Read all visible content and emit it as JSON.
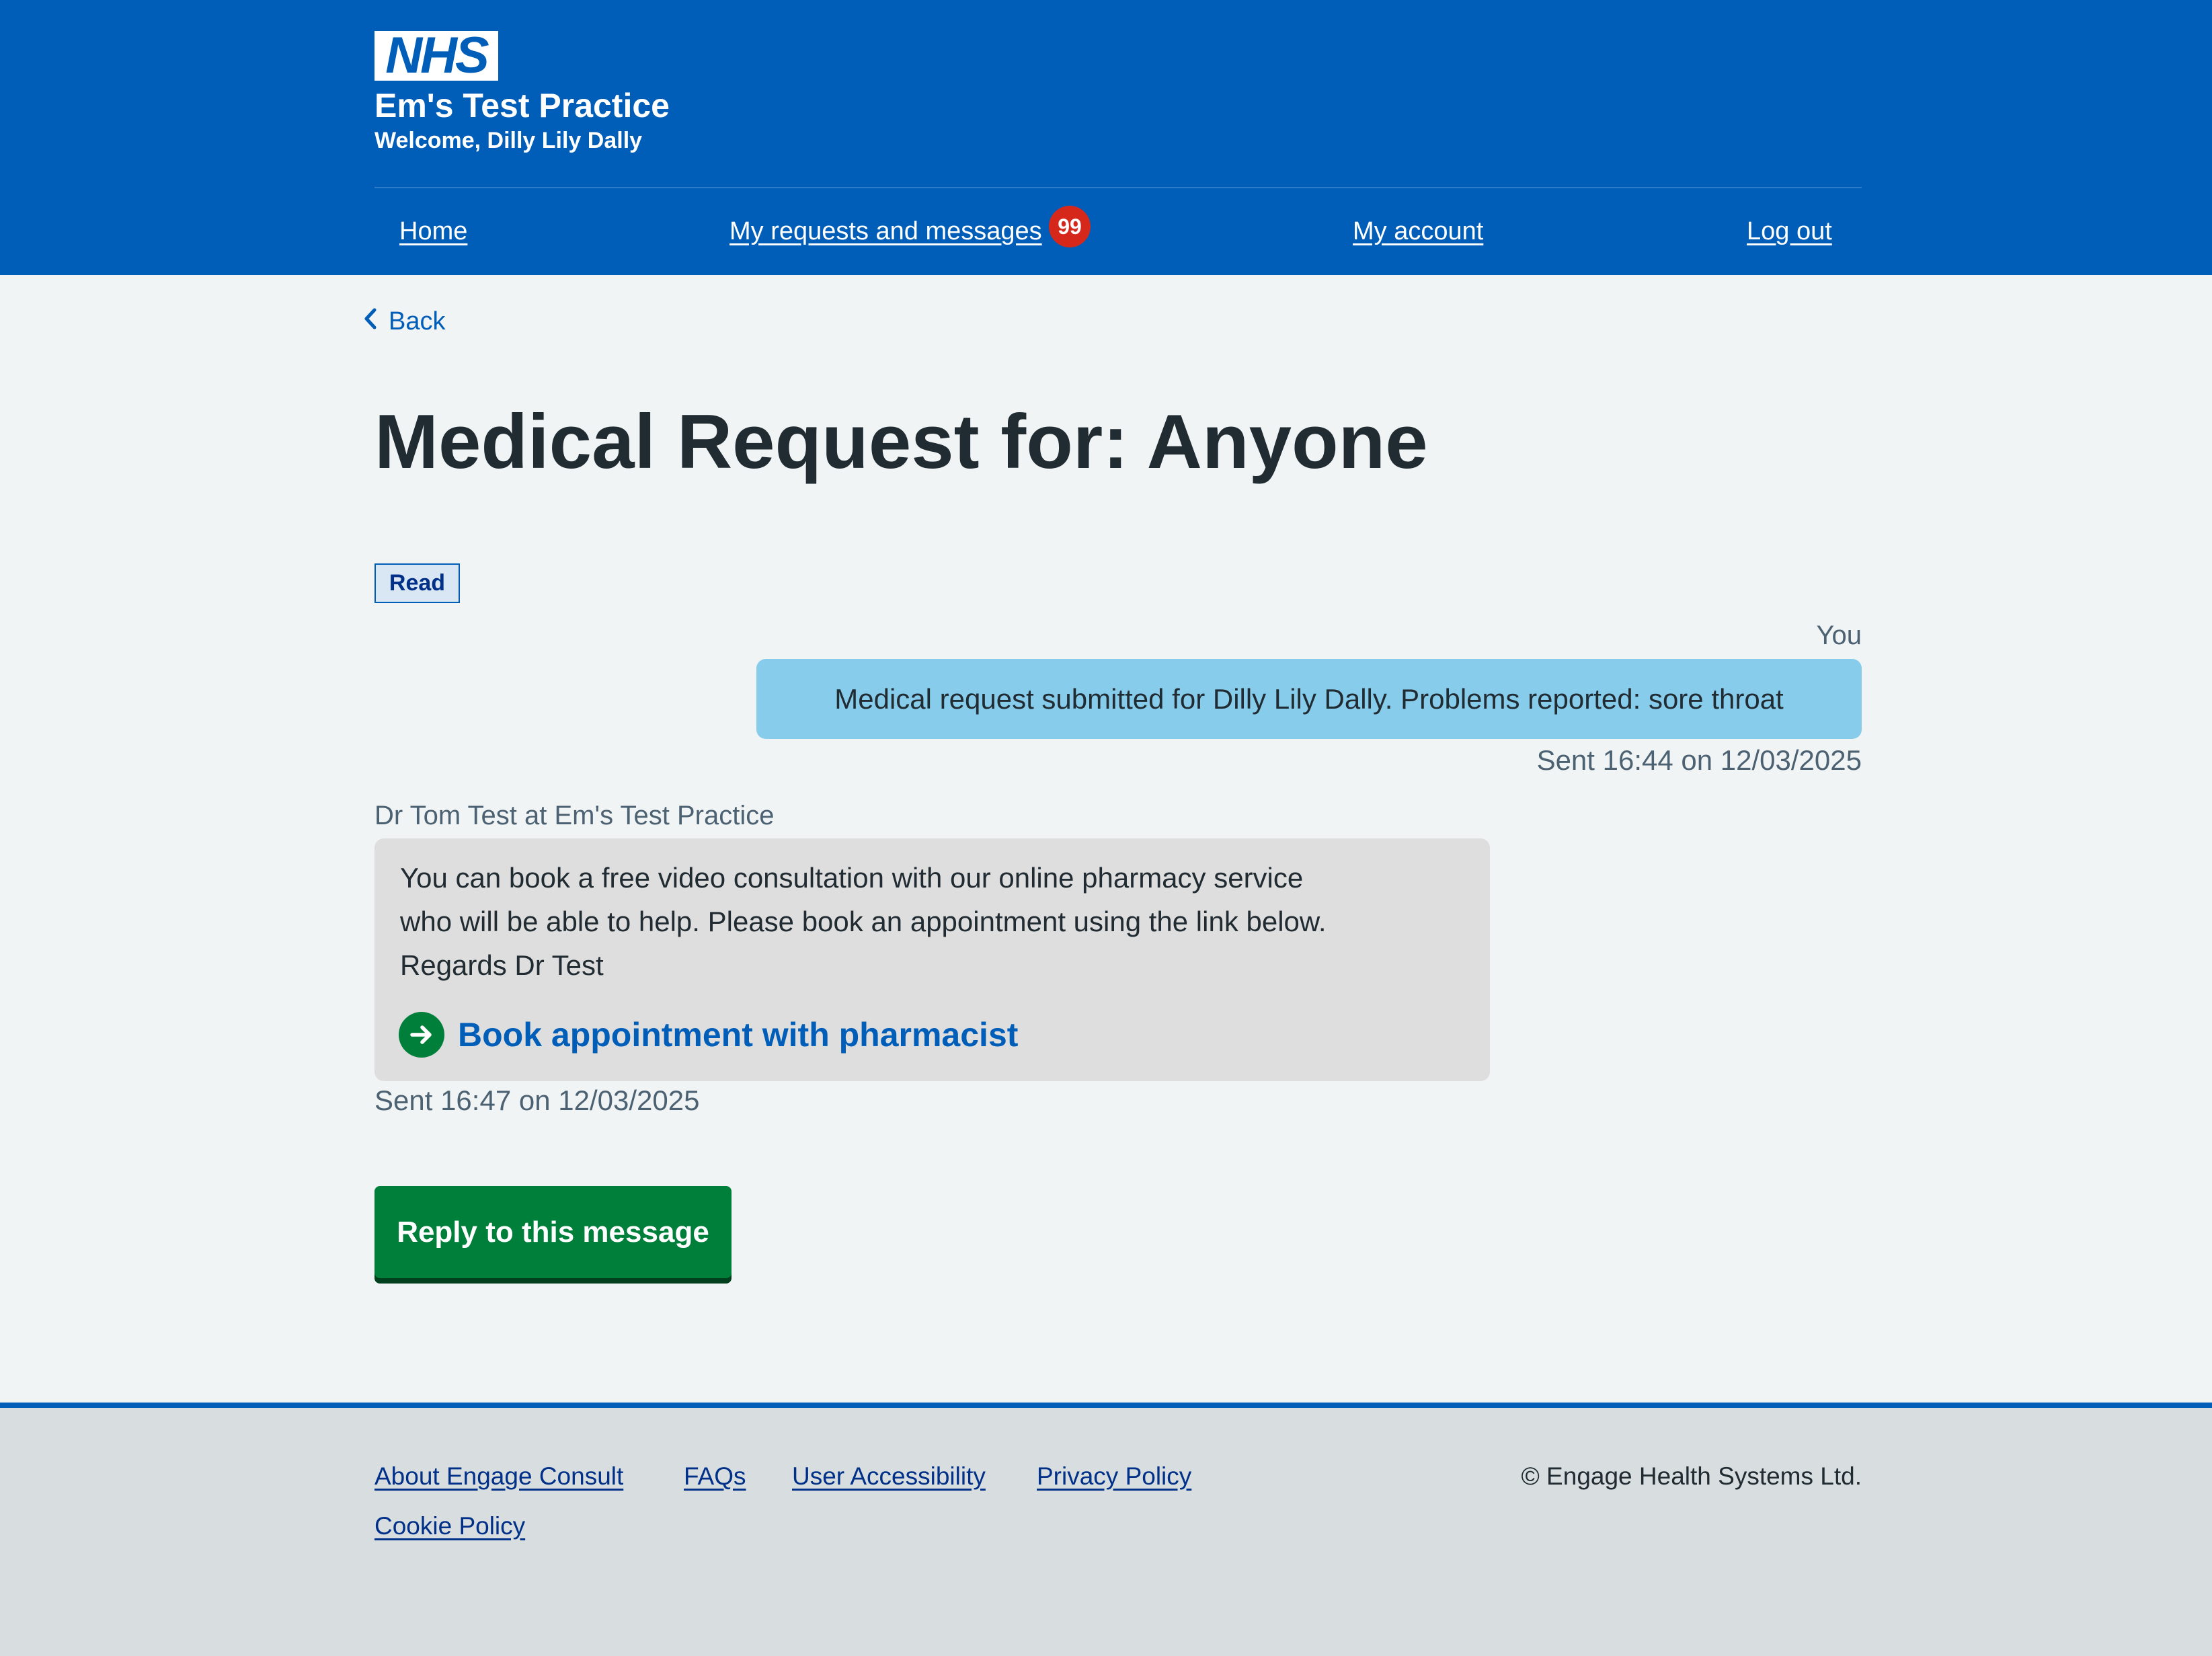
{
  "header": {
    "logo_text": "NHS",
    "practice_name": "Em's Test Practice",
    "welcome": "Welcome, Dilly Lily Dally",
    "nav": [
      {
        "label": "Home"
      },
      {
        "label": "My requests and messages",
        "badge": "99"
      },
      {
        "label": "My account"
      },
      {
        "label": "Log out"
      }
    ]
  },
  "main": {
    "back_label": "Back",
    "title": "Medical Request for: Anyone",
    "status_tag": "Read",
    "messages": [
      {
        "sender": "You",
        "text": "Medical request submitted for Dilly Lily Dally. Problems reported: sore throat",
        "sent": "Sent 16:44 on 12/03/2025"
      },
      {
        "sender": "Dr Tom Test at Em's Test Practice",
        "text_lines": [
          "You can book a free video consultation with our online pharmacy service",
          "who will be able to help. Please book an appointment using the link below.",
          "Regards Dr Test"
        ],
        "action_link": "Book appointment with pharmacist",
        "sent": "Sent 16:47 on 12/03/2025"
      }
    ],
    "reply_button": "Reply to this message"
  },
  "footer": {
    "links": [
      {
        "label": "About Engage Consult"
      },
      {
        "label": "FAQs"
      },
      {
        "label": "User Accessibility"
      },
      {
        "label": "Privacy Policy"
      },
      {
        "label": "Cookie Policy"
      }
    ],
    "copyright": "© Engage Health Systems Ltd."
  },
  "colors": {
    "nhs_blue": "#005eb8",
    "background": "#f0f4f5",
    "user_bubble": "#88ccec",
    "reply_bubble": "#dedede",
    "green": "#007f3b",
    "badge_red": "#d5281b",
    "footer_bg": "#d8dde0"
  },
  "icons": [
    "back-chevron-icon",
    "arrow-right-circle-icon"
  ]
}
